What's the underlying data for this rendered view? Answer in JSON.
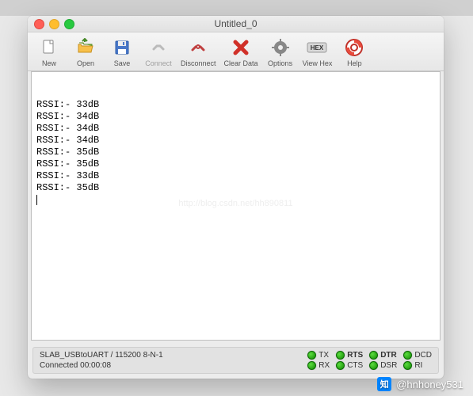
{
  "window": {
    "title": "Untitled_0"
  },
  "toolbar": {
    "new": "New",
    "open": "Open",
    "save": "Save",
    "connect": "Connect",
    "disconnect": "Disconnect",
    "clear": "Clear Data",
    "options": "Options",
    "viewhex": "View Hex",
    "help": "Help"
  },
  "terminal": {
    "lines": [
      "RSSI:- 33dB",
      "RSSI:- 34dB",
      "RSSI:- 34dB",
      "RSSI:- 34dB",
      "RSSI:- 35dB",
      "RSSI:- 35dB",
      "RSSI:- 33dB",
      "RSSI:- 35dB"
    ],
    "watermark": "http://blog.csdn.net/hh890811"
  },
  "status": {
    "port": "SLAB_USBtoUART / 115200 8-N-1",
    "conn": "Connected 00:00:08",
    "leds": {
      "tx": {
        "label": "TX",
        "on": true
      },
      "rx": {
        "label": "RX",
        "on": true
      },
      "rts": {
        "label": "RTS",
        "on": true
      },
      "cts": {
        "label": "CTS",
        "on": true
      },
      "dtr": {
        "label": "DTR",
        "on": true
      },
      "dsr": {
        "label": "DSR",
        "on": true
      },
      "dcd": {
        "label": "DCD",
        "on": true
      },
      "ri": {
        "label": "RI",
        "on": true
      }
    }
  },
  "attribution": {
    "handle": "@hnhoney531",
    "logo": "知"
  }
}
